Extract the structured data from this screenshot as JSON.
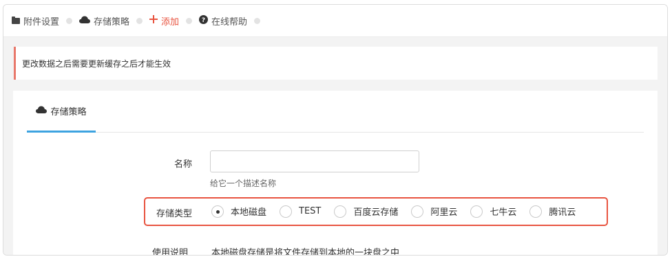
{
  "breadcrumb": {
    "items": [
      {
        "label": "附件设置",
        "icon": "folder-icon"
      },
      {
        "label": "存储策略",
        "icon": "cloud-icon"
      },
      {
        "label": "添加",
        "icon": "plus-icon",
        "color": "#e8533f"
      },
      {
        "label": "在线帮助",
        "icon": "help-circle-icon"
      }
    ]
  },
  "notice": {
    "text": "更改数据之后需要更新缓存之后才能生效",
    "accent_color": "#e8786b"
  },
  "tabs": [
    {
      "label": "存储策略",
      "icon": "cloud-icon",
      "active": true,
      "underline_color": "#3da3e0"
    }
  ],
  "form": {
    "name": {
      "label": "名称",
      "value": "",
      "hint": "给它一个描述名称"
    },
    "storage_type": {
      "label": "存储类型",
      "highlight_color": "#e8533f",
      "options": [
        {
          "label": "本地磁盘",
          "selected": true
        },
        {
          "label": "TEST",
          "selected": false
        },
        {
          "label": "百度云存储",
          "selected": false
        },
        {
          "label": "阿里云",
          "selected": false
        },
        {
          "label": "七牛云",
          "selected": false
        },
        {
          "label": "腾讯云",
          "selected": false
        }
      ]
    },
    "usage": {
      "label": "使用说明",
      "text": "本地磁盘存储是将文件存储到本地的一块盘之中"
    }
  }
}
